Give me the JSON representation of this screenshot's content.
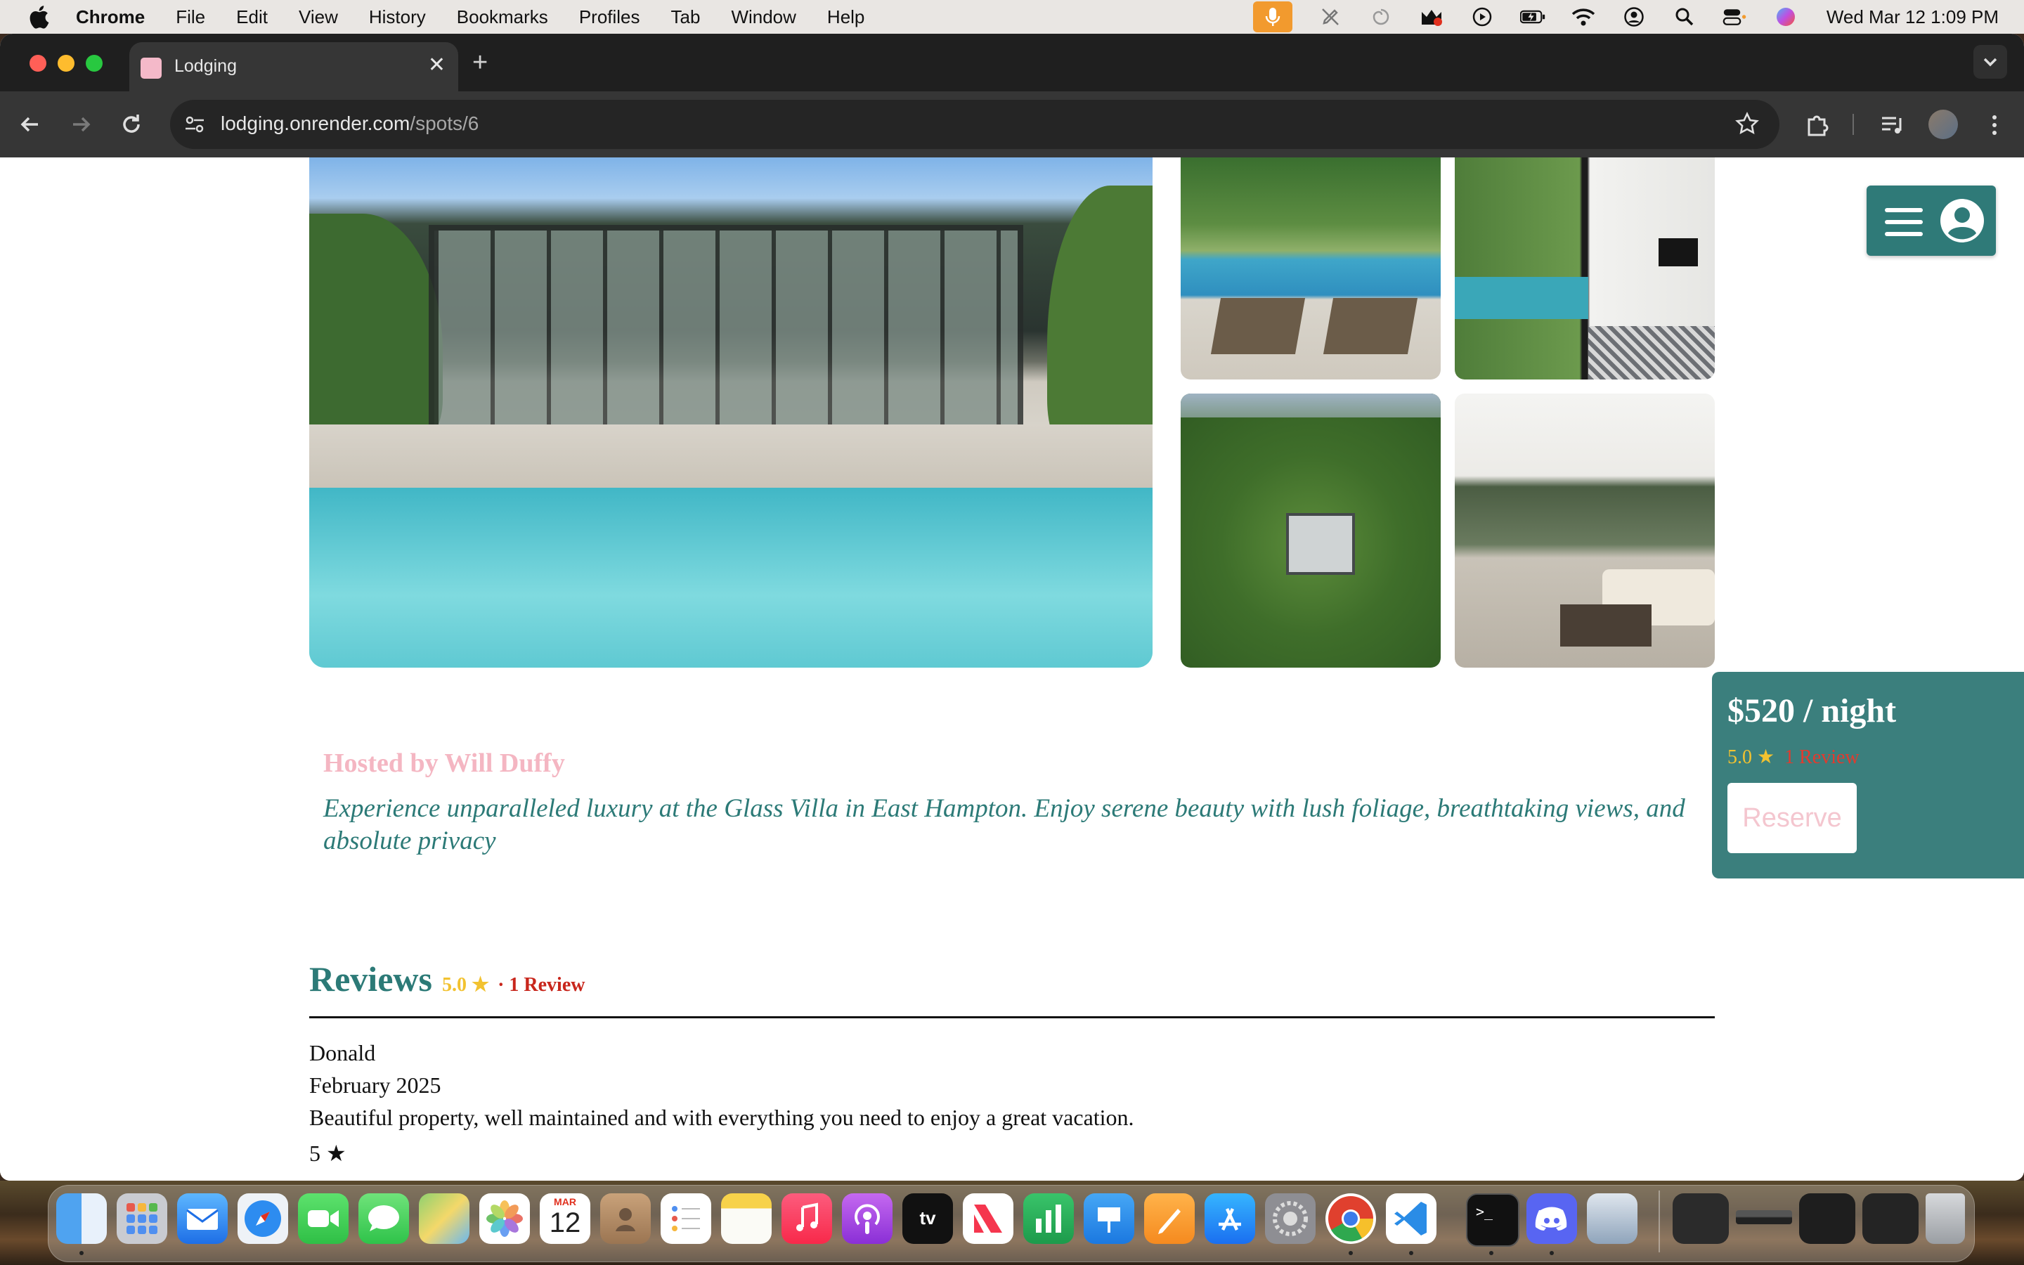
{
  "menubar": {
    "app": "Chrome",
    "items": [
      "File",
      "Edit",
      "View",
      "History",
      "Bookmarks",
      "Profiles",
      "Tab",
      "Window",
      "Help"
    ],
    "datetime": "Wed Mar 12  1:09 PM"
  },
  "browser": {
    "tab_title": "Lodging",
    "url_host": "lodging.onrender.com",
    "url_path": "/spots/6"
  },
  "listing": {
    "host": "Hosted by Will Duffy",
    "description": "Experience unparalleled luxury at the Glass Villa in East Hampton. Enjoy serene beauty with lush foliage, breathtaking views, and absolute privacy",
    "price": "$520 / night",
    "rating": "5.0 ★",
    "review_count": "1 Review",
    "reserve_label": "Reserve"
  },
  "reviews": {
    "title": "Reviews",
    "rating": "5.0 ★",
    "count": "· 1 Review",
    "items": [
      {
        "author": "Donald",
        "date": "February 2025",
        "text": "Beautiful property, well maintained and with everything you need to enjoy a great vacation.",
        "stars": "5 ★"
      }
    ]
  },
  "dock": {
    "calendar_month": "MAR",
    "calendar_day": "12",
    "tv_label": "tv"
  },
  "colors": {
    "teal": "#2c7a77",
    "card_teal": "#3b7f7d",
    "host_pink": "#f4b6c2",
    "star_gold": "#f2c230",
    "review_red": "#c8261c"
  }
}
